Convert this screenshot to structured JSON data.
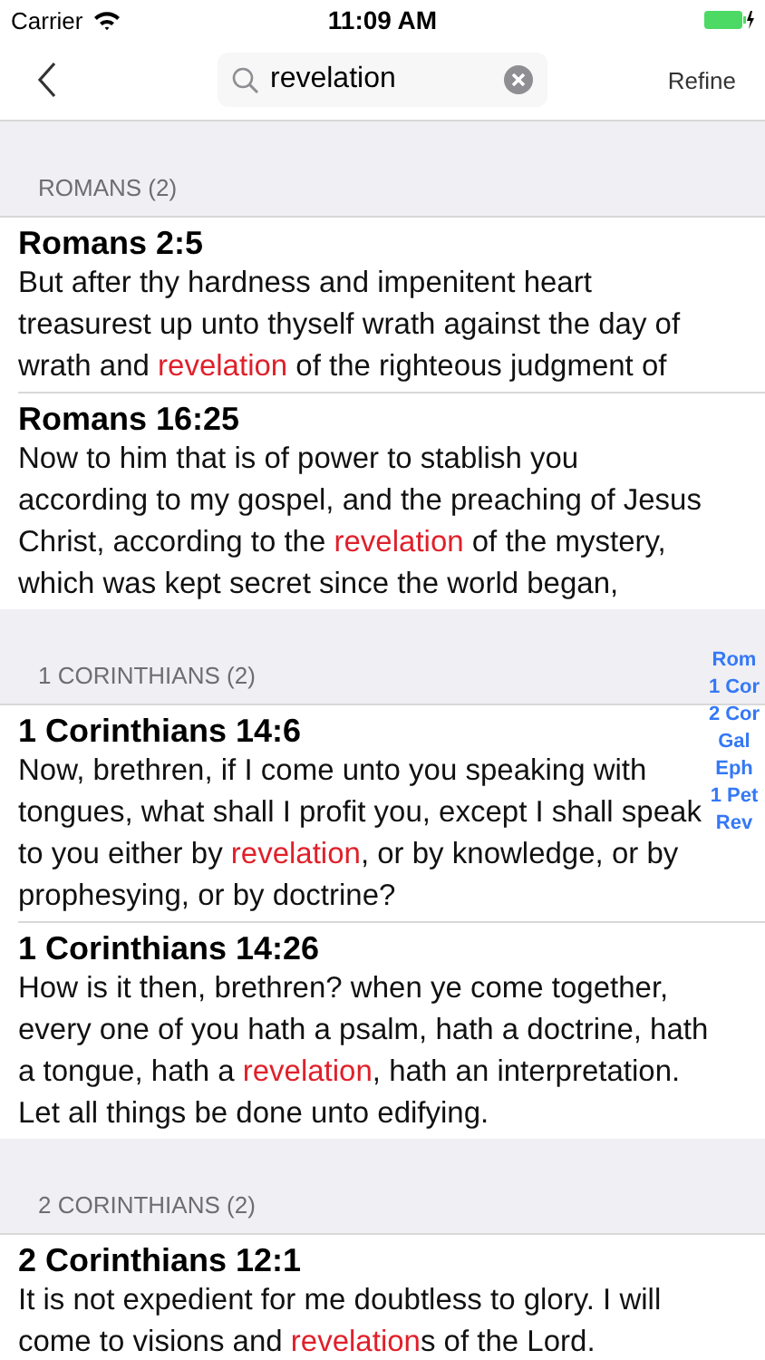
{
  "status_bar": {
    "carrier": "Carrier",
    "time": "11:09 AM"
  },
  "nav": {
    "search_value": "revelation",
    "refine": "Refine"
  },
  "sections": [
    {
      "header": "ROMANS (2)",
      "verses": [
        {
          "reference": "Romans 2:5",
          "segments": [
            {
              "text": "But after thy hardness and impenitent heart treasurest up unto thyself wrath against the day of wrath and ",
              "match": false
            },
            {
              "text": "revelation",
              "match": true
            },
            {
              "text": " of the righteous judgment of",
              "match": false
            }
          ]
        },
        {
          "reference": "Romans 16:25",
          "segments": [
            {
              "text": "Now to him that is of power to stablish you according to my gospel, and the preaching of Jesus Christ, according to the ",
              "match": false
            },
            {
              "text": "revelation",
              "match": true
            },
            {
              "text": " of the mystery, which was kept secret since the world began,",
              "match": false
            }
          ]
        }
      ]
    },
    {
      "header": "1 CORINTHIANS (2)",
      "verses": [
        {
          "reference": "1 Corinthians 14:6",
          "segments": [
            {
              "text": "Now, brethren, if I come unto you speaking with tongues, what shall I profit you, except I shall speak to you either by ",
              "match": false
            },
            {
              "text": "revelation",
              "match": true
            },
            {
              "text": ", or by knowledge, or by prophesying, or by doctrine?",
              "match": false
            }
          ]
        },
        {
          "reference": "1 Corinthians 14:26",
          "segments": [
            {
              "text": "How is it then, brethren? when ye come together, every one of you hath a psalm, hath a doctrine, hath a tongue, hath a ",
              "match": false
            },
            {
              "text": "revelation",
              "match": true
            },
            {
              "text": ", hath an interpretation. Let all things be done unto edifying.",
              "match": false
            }
          ]
        }
      ]
    },
    {
      "header": "2 CORINTHIANS (2)",
      "verses": [
        {
          "reference": "2 Corinthians 12:1",
          "segments": [
            {
              "text": "It is not expedient for me doubtless to glory. I will come to visions and ",
              "match": false
            },
            {
              "text": "revelation",
              "match": true
            },
            {
              "text": "s of the Lord.",
              "match": false
            }
          ]
        }
      ]
    }
  ],
  "section_index": [
    "Rom",
    "1 Cor",
    "2 Cor",
    "Gal",
    "Eph",
    "1 Pet",
    "Rev"
  ]
}
